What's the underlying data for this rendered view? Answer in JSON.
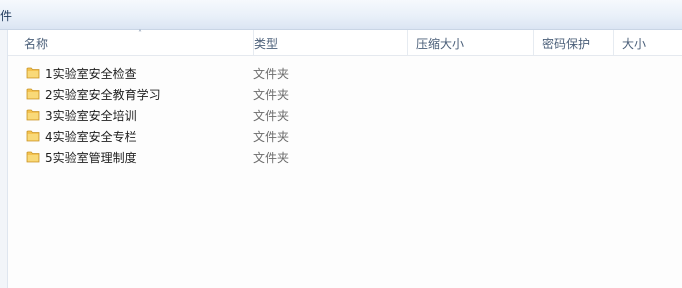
{
  "toolbar": {
    "partial_label": "件"
  },
  "columns": {
    "name": "名称",
    "type": "类型",
    "compressed_size": "压缩大小",
    "password": "密码保护",
    "size": "大小"
  },
  "sort_indicator": "˄",
  "files": [
    {
      "name": "1实验室安全检查",
      "type": "文件夹",
      "icon": "folder-icon"
    },
    {
      "name": "2实验室安全教育学习",
      "type": "文件夹",
      "icon": "folder-icon"
    },
    {
      "name": "3实验室安全培训",
      "type": "文件夹",
      "icon": "folder-icon"
    },
    {
      "name": "4实验室安全专栏",
      "type": "文件夹",
      "icon": "folder-icon"
    },
    {
      "name": "5实验室管理制度",
      "type": "文件夹",
      "icon": "folder-icon"
    }
  ],
  "colors": {
    "header_text": "#4c607a",
    "type_text": "#6d6d6d",
    "folder_fill": "#f4c24f",
    "folder_edge": "#c9962a"
  }
}
